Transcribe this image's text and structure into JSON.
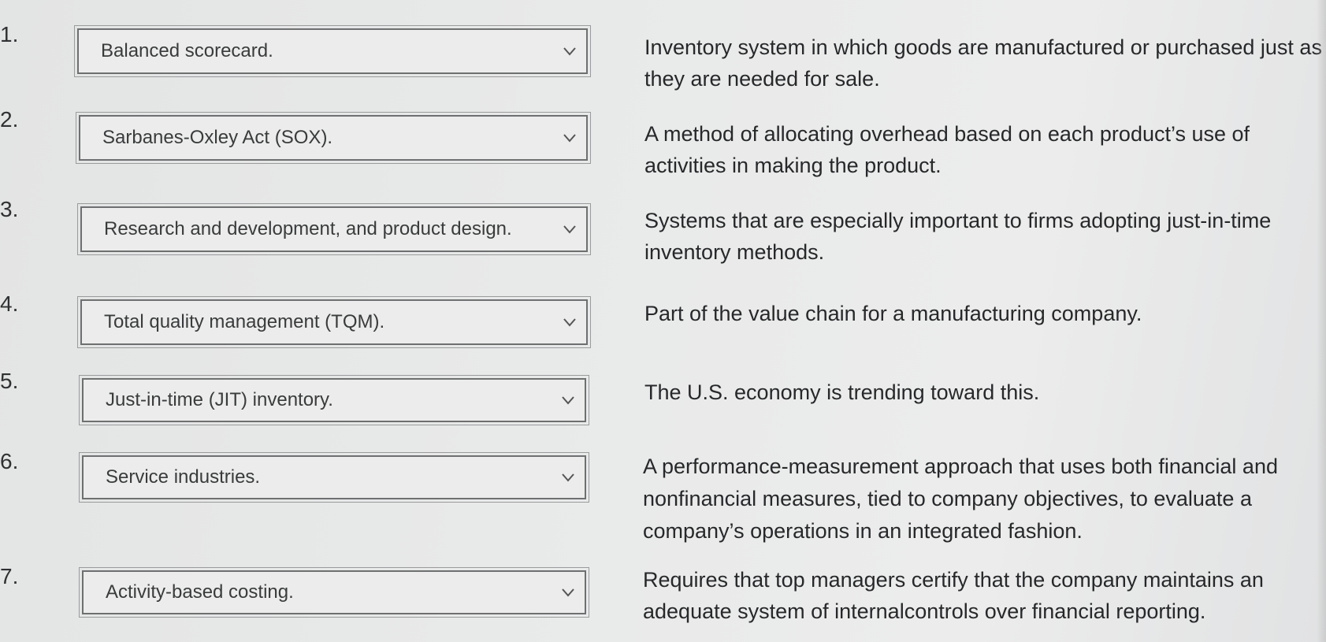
{
  "items": [
    {
      "number": "1.",
      "selected": "Balanced scorecard.",
      "description": "Inventory system in which goods are manufactured or purchased just as they are needed for sale."
    },
    {
      "number": "2.",
      "selected": "Sarbanes-Oxley Act (SOX).",
      "description": "A method of allocating overhead based on each product’s use of activities in making the product."
    },
    {
      "number": "3.",
      "selected": "Research and development, and product design.",
      "description": "Systems that are especially important to firms adopting just-in-time inventory methods."
    },
    {
      "number": "4.",
      "selected": "Total quality management (TQM).",
      "description": "Part of the value chain for a manufacturing company."
    },
    {
      "number": "5.",
      "selected": "Just-in-time (JIT) inventory.",
      "description": "The U.S. economy is trending toward this."
    },
    {
      "number": "6.",
      "selected": "Service industries.",
      "description": "A performance-measurement approach that uses both financial and nonfinancial measures, tied to company objectives, to evaluate a company’s operations in an integrated fashion."
    },
    {
      "number": "7.",
      "selected": "Activity-based costing.",
      "description": "Requires that top managers certify that the company maintains an adequate system of internalcontrols over financial reporting."
    }
  ],
  "icons": {
    "dropdown_arrow": "chevron-down-icon"
  }
}
